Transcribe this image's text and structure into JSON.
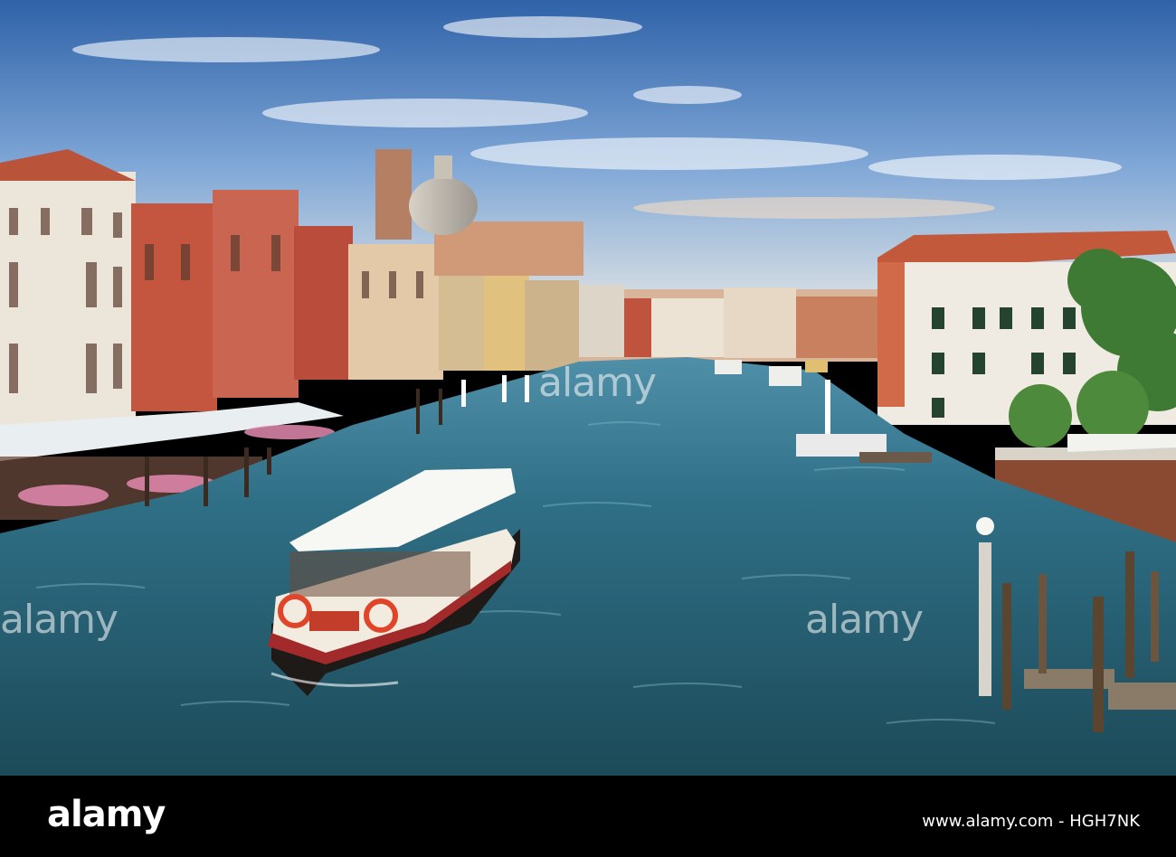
{
  "photo": {
    "subject": "",
    "watermark_text": "alamy",
    "palette": {
      "sky_top": "#3b6fb2",
      "sky_mid": "#9bbbe0",
      "sky_horizon": "#f1d3b4",
      "water_dark": "#1e4f5e",
      "water_light": "#3d8aa0",
      "terracotta": "#c4593a",
      "pale_building": "#ebe4d6",
      "dome": "#b9b3aa"
    }
  },
  "footer": {
    "logo": "alamy",
    "image_ref": "www.alamy.com - HGH7NK"
  }
}
